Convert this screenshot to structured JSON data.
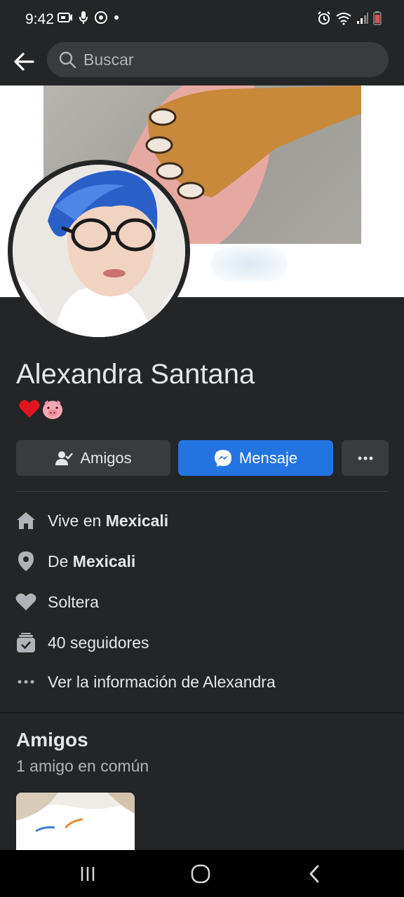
{
  "status_bar": {
    "time": "9:42",
    "left_icons": [
      "screen-record-icon",
      "mic-icon",
      "hotspot-icon",
      "dot-icon"
    ],
    "right_icons": [
      "alarm-icon",
      "wifi-icon",
      "signal-icon",
      "battery-icon"
    ]
  },
  "top_bar": {
    "search_placeholder": "Buscar"
  },
  "profile": {
    "name": "Alexandra Santana",
    "bio": "❤️🐷"
  },
  "actions": {
    "friends_label": "Amigos",
    "message_label": "Mensaje",
    "more_label": "•••"
  },
  "info": {
    "lives_prefix": "Vive en ",
    "lives_city": "Mexicali",
    "from_prefix": "De ",
    "from_city": "Mexicali",
    "relationship": "Soltera",
    "followers": "40 seguidores",
    "see_more": "Ver la información de Alexandra"
  },
  "friends": {
    "title": "Amigos",
    "mutual": "1 amigo en común"
  },
  "colors": {
    "background": "#242526",
    "button_gray": "#3a3b3c",
    "messenger_blue": "#2374e1",
    "text_primary": "#e4e6eb",
    "text_secondary": "#b0b3b8"
  }
}
